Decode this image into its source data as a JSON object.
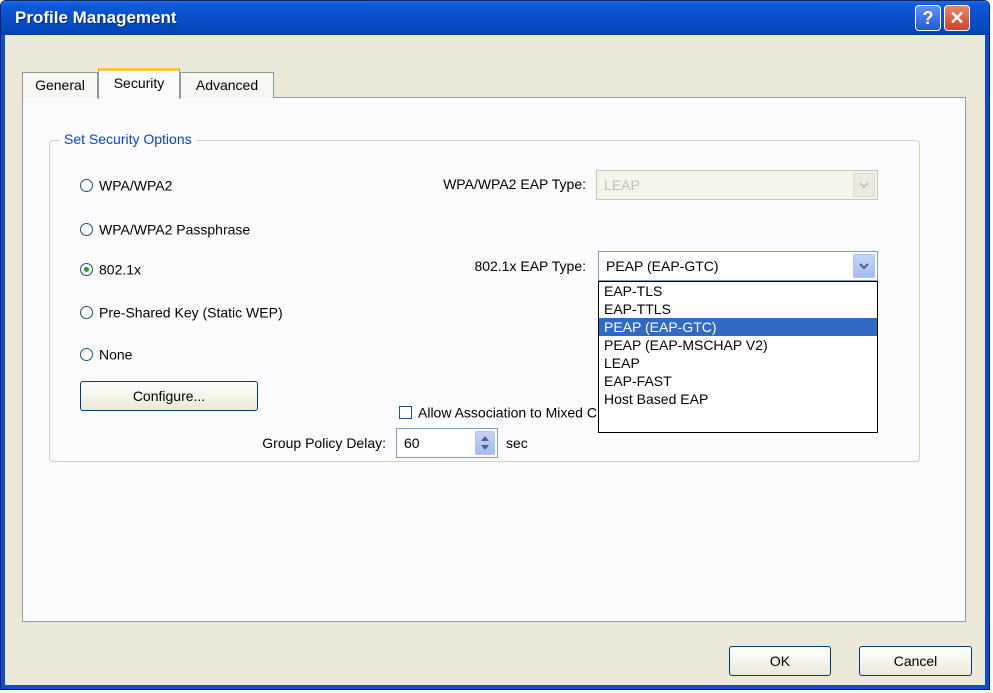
{
  "window": {
    "title": "Profile Management",
    "help_icon": "?",
    "close_icon": "✕"
  },
  "tabs": [
    {
      "label": "General"
    },
    {
      "label": "Security"
    },
    {
      "label": "Advanced"
    }
  ],
  "group": {
    "label": "Set Security Options"
  },
  "radios": [
    {
      "label": "WPA/WPA2",
      "checked": false
    },
    {
      "label": "WPA/WPA2 Passphrase",
      "checked": false
    },
    {
      "label": "802.1x",
      "checked": true
    },
    {
      "label": "Pre-Shared Key (Static WEP)",
      "checked": false
    },
    {
      "label": "None",
      "checked": false
    }
  ],
  "configure_label": "Configure...",
  "wpa_eap": {
    "label": "WPA/WPA2 EAP Type:",
    "value": "LEAP",
    "enabled": false
  },
  "dot1x_eap": {
    "label": "802.1x EAP Type:",
    "value": "PEAP (EAP-GTC)",
    "options": [
      "EAP-TLS",
      "EAP-TTLS",
      "PEAP (EAP-GTC)",
      "PEAP (EAP-MSCHAP V2)",
      "LEAP",
      "EAP-FAST",
      "Host Based EAP"
    ],
    "selected_index": 2
  },
  "allow_association": {
    "label": "Allow Association to Mixed Cells",
    "checked": false
  },
  "group_policy": {
    "label": "Group Policy Delay:",
    "value": "60",
    "unit": "sec"
  },
  "buttons": {
    "ok": "OK",
    "cancel": "Cancel"
  },
  "colors": {
    "title_bar": "#0a4fc9",
    "group_label": "#0046d5",
    "selection": "#316ac5",
    "radio_dot": "#21a121",
    "tab_highlight": "#ffc83c"
  }
}
